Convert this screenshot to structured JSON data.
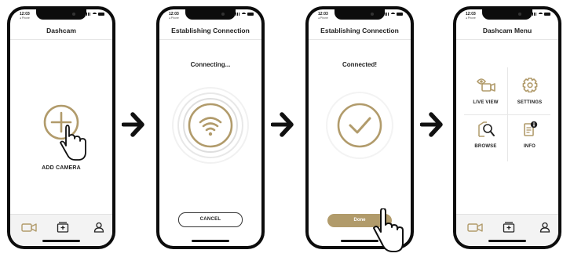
{
  "status_bar": {
    "time": "12:03",
    "carrier": "◂ Phone"
  },
  "colors": {
    "accent_gold": "#b19b6b",
    "phone_frame": "#0c0c0c",
    "arrow": "#111111"
  },
  "screen1": {
    "title": "Dashcam",
    "add_label": "ADD CAMERA",
    "icons": [
      "add-circle-icon",
      "pointing-hand-icon"
    ],
    "tabs": [
      "camera-tab-icon",
      "gallery-tab-icon",
      "profile-tab-icon"
    ]
  },
  "screen2": {
    "title": "Establishing Connection",
    "status": "Connecting...",
    "cancel_label": "CANCEL",
    "icons": [
      "wifi-icon"
    ]
  },
  "screen3": {
    "title": "Establishing Connection",
    "status": "Connected!",
    "done_label": "Done",
    "icons": [
      "checkmark-icon",
      "pointing-hand-icon"
    ]
  },
  "screen4": {
    "title": "Dashcam Menu",
    "menu": [
      {
        "label": "LIVE VIEW",
        "icon": "live-view-icon"
      },
      {
        "label": "SETTINGS",
        "icon": "settings-gear-icon"
      },
      {
        "label": "BROWSE",
        "icon": "browse-search-icon"
      },
      {
        "label": "INFO",
        "icon": "info-document-icon"
      }
    ],
    "tabs": [
      "camera-tab-icon",
      "gallery-tab-icon",
      "profile-tab-icon"
    ]
  },
  "arrows": [
    "arrow-right-icon",
    "arrow-right-icon",
    "arrow-right-icon"
  ]
}
